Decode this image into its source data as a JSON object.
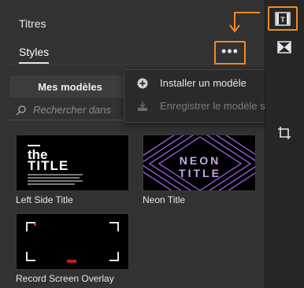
{
  "panel": {
    "titres_label": "Titres",
    "styles_label": "Styles",
    "more_label": "•••",
    "tab_label": "Mes modèles",
    "search_placeholder": "Rechercher dans"
  },
  "menu": {
    "items": [
      {
        "label": "Installer un modèle",
        "icon": "plus-circle-icon",
        "enabled": true
      },
      {
        "label": "Enregistrer le modèle sous",
        "icon": "save-icon",
        "enabled": false
      }
    ]
  },
  "templates": [
    {
      "name": "Left Side Title",
      "thumb_line1": "the",
      "thumb_line2": "TITLE"
    },
    {
      "name": "Neon Title",
      "thumb_line1": "NEON",
      "thumb_line2": "TITLE"
    },
    {
      "name": "Record Screen Overlay"
    }
  ],
  "rightbar": {
    "icons": [
      "titles-film-icon",
      "transition-icon",
      "crop-icon"
    ],
    "active_icon": "titles-film-icon"
  },
  "colors": {
    "accent_orange": "#f08a24",
    "panel_bg": "#323232",
    "neon_purple": "#b46cff"
  }
}
